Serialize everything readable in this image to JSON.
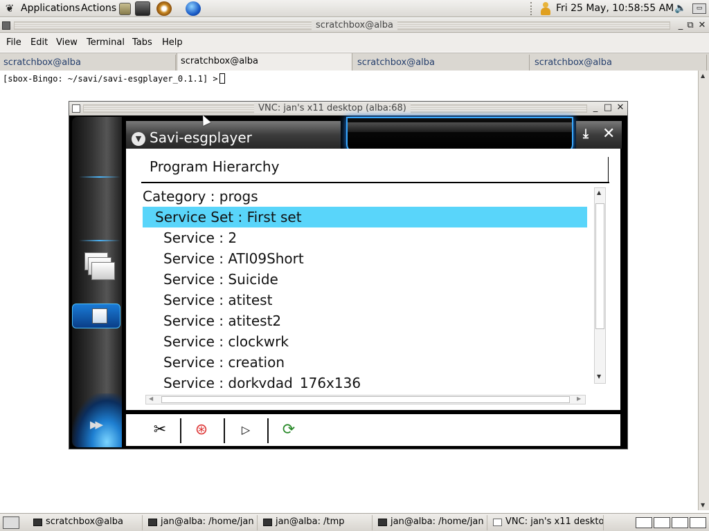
{
  "top_panel": {
    "applications": "Applications",
    "actions": "Actions",
    "clock": "Fri 25 May, 10:58:55 AM"
  },
  "terminal": {
    "title": "scratchbox@alba",
    "menu": [
      "File",
      "Edit",
      "View",
      "Terminal",
      "Tabs",
      "Help"
    ],
    "tabs": [
      "scratchbox@alba",
      "scratchbox@alba",
      "scratchbox@alba",
      "scratchbox@alba"
    ],
    "prompt": "[sbox-Bingo: ~/savi/savi-esgplayer_0.1.1] >"
  },
  "vnc": {
    "title": "VNC: jan's x11 desktop (alba:68)",
    "app_title": "Savi-esgplayer",
    "section_title": "Program Hierarchy",
    "tree": [
      {
        "label": "Category : progs",
        "level": 0,
        "selected": false
      },
      {
        "label": "Service Set : First set",
        "level": 1,
        "selected": true
      },
      {
        "label": "Service : 2",
        "level": 2,
        "selected": false
      },
      {
        "label": "Service : ATI09Short",
        "level": 2,
        "selected": false
      },
      {
        "label": "Service : Suicide",
        "level": 2,
        "selected": false
      },
      {
        "label": "Service : atitest",
        "level": 2,
        "selected": false
      },
      {
        "label": "Service : atitest2",
        "level": 2,
        "selected": false
      },
      {
        "label": "Service : clockwrk",
        "level": 2,
        "selected": false
      },
      {
        "label": "Service : creation",
        "level": 2,
        "selected": false
      },
      {
        "label": "Service : dorkydad_176x136",
        "level": 2,
        "selected": false
      }
    ],
    "selection_color": "#59d5fa",
    "accent_color": "#3aa9ff"
  },
  "taskbar": {
    "tasks": [
      "scratchbox@alba",
      "jan@alba: /home/jan",
      "jan@alba: /tmp",
      "jan@alba: /home/jan",
      "VNC: jan's x11 deskto"
    ]
  }
}
